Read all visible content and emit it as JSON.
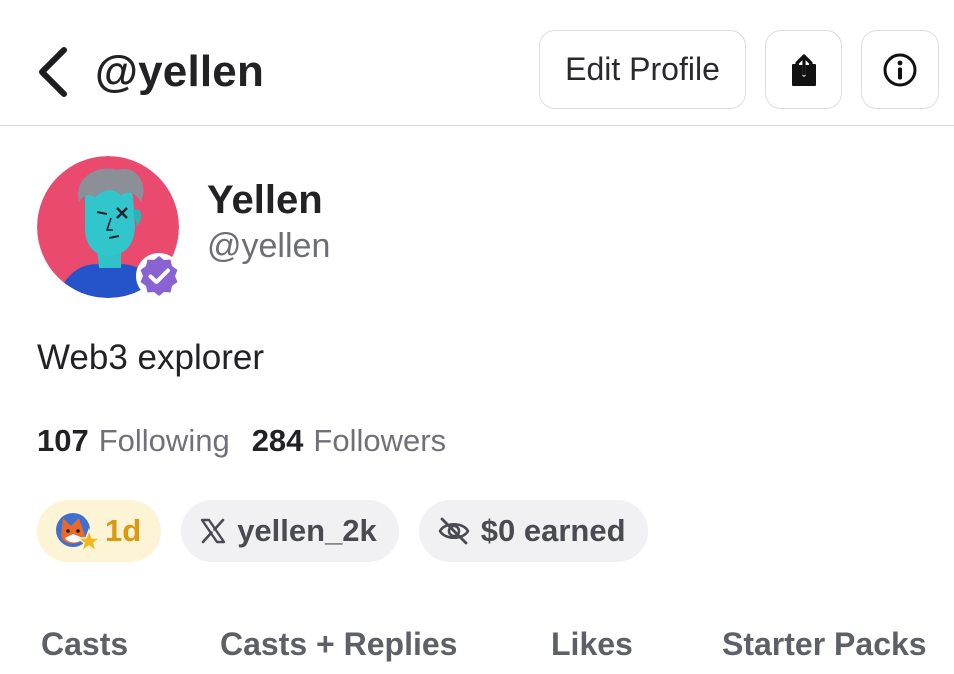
{
  "header": {
    "title": "@yellen",
    "edit_label": "Edit Profile"
  },
  "profile": {
    "display_name": "Yellen",
    "username": "@yellen",
    "bio": "Web3 explorer",
    "verified": true
  },
  "stats": {
    "following_count": "107",
    "following_label": "Following",
    "followers_count": "284",
    "followers_label": "Followers"
  },
  "badges": {
    "age": "1d",
    "x_handle": "yellen_2k",
    "earned": "$0 earned"
  },
  "tabs": [
    {
      "label": "Casts"
    },
    {
      "label": "Casts + Replies"
    },
    {
      "label": "Likes"
    },
    {
      "label": "Starter Packs"
    }
  ],
  "colors": {
    "verified": "#8a63d2",
    "age_badge_bg": "#fdf3d5",
    "age_badge_text": "#d99a12",
    "chip_bg": "#f1f1f3"
  },
  "icons": {
    "back": "chevron-left-icon",
    "share": "share-icon",
    "info": "info-icon",
    "verified": "verified-badge-icon",
    "x": "x-logo-icon",
    "earned": "eye-off-icon",
    "age": "fox-star-icon"
  }
}
